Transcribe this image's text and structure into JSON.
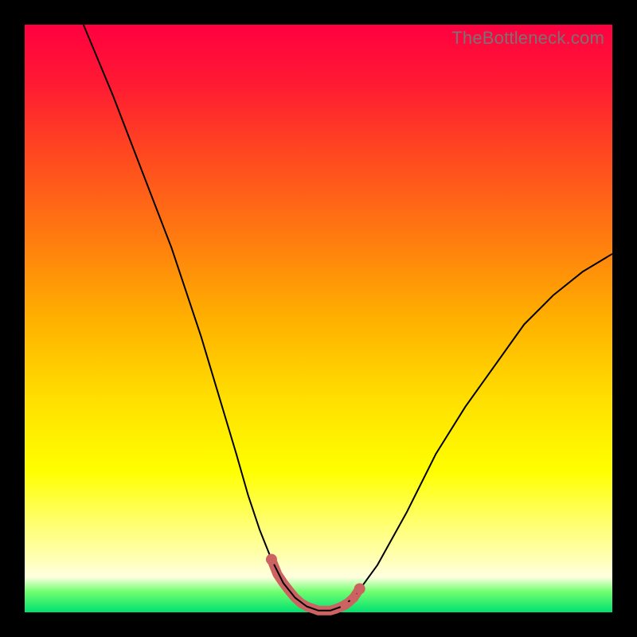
{
  "watermark": "TheBottleneck.com",
  "chart_data": {
    "type": "line",
    "title": "",
    "xlabel": "",
    "ylabel": "",
    "xlim": [
      0,
      100
    ],
    "ylim": [
      0,
      100
    ],
    "series": [
      {
        "name": "bottleneck-curve-black",
        "stroke": "#000000",
        "stroke_width": 2.0,
        "x": [
          10,
          15,
          20,
          25,
          30,
          33,
          36,
          38,
          40,
          42,
          44,
          46,
          48,
          50,
          52,
          54,
          56,
          60,
          65,
          70,
          75,
          80,
          85,
          90,
          95,
          100
        ],
        "y": [
          100,
          88,
          75,
          62,
          47,
          37,
          27,
          20,
          14,
          9,
          5,
          2.5,
          1,
          0.3,
          0.3,
          1,
          2.5,
          8,
          17,
          27,
          35,
          42,
          49,
          54,
          58,
          61
        ]
      },
      {
        "name": "bottleneck-curve-red-bottom",
        "stroke": "#cd6262",
        "stroke_width": 12,
        "linecap": "round",
        "x": [
          42,
          43,
          44,
          45,
          46,
          47,
          48,
          50,
          52,
          53,
          54,
          55,
          56,
          57
        ],
        "y": [
          9,
          6.5,
          5,
          3.7,
          2.5,
          1.6,
          1,
          0.3,
          0.3,
          0.6,
          1,
          1.6,
          2.5,
          4
        ]
      }
    ],
    "markers": [
      {
        "name": "red-dot-left",
        "x": 42,
        "y": 9,
        "r": 7,
        "color": "#cd6262"
      },
      {
        "name": "red-dot-right",
        "x": 57,
        "y": 4,
        "r": 7,
        "color": "#cd6262"
      },
      {
        "name": "red-dot-mid1",
        "x": 54.5,
        "y": 1.2,
        "r": 6,
        "color": "#cd6262"
      },
      {
        "name": "red-dot-mid2",
        "x": 56,
        "y": 2.5,
        "r": 6,
        "color": "#cd6262"
      }
    ]
  }
}
